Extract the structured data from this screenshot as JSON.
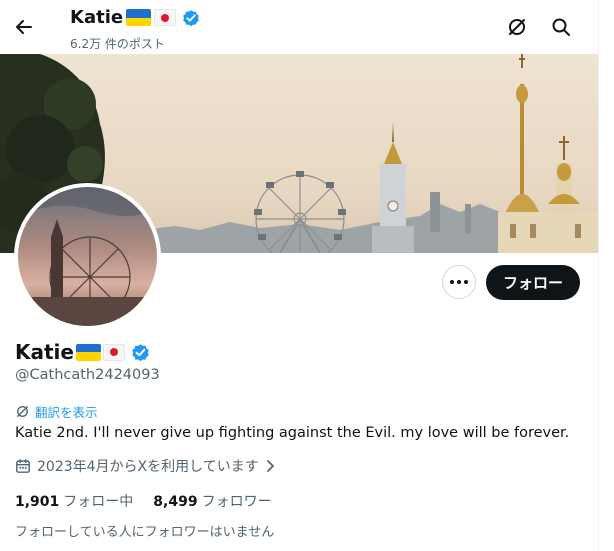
{
  "header": {
    "name": "Katie",
    "post_count": "6.2万 件のポスト"
  },
  "profile": {
    "name": "Katie",
    "handle": "@Cathcath2424093",
    "translate_label": "翻訳を表示",
    "bio": "Katie 2nd. I'll never give up fighting against the Evil. my love will be forever.",
    "joined": "2023年4月からXを利用しています",
    "following_count": "1,901",
    "following_label": "フォロー中",
    "followers_count": "8,499",
    "followers_label": "フォロワー",
    "no_followers_note": "フォローしている人にフォロワーはいません"
  },
  "actions": {
    "follow_label": "フォロー"
  },
  "icons": {
    "back": "back-arrow-icon",
    "grok": "grok-icon",
    "search": "search-icon",
    "verified": "verified-badge-icon",
    "translate": "translate-icon",
    "calendar": "calendar-icon",
    "more": "more-icon"
  },
  "colors": {
    "accent": "#1d9bf0",
    "text": "#0f1419",
    "secondary": "#536471",
    "follow_button": "#0f1419"
  }
}
